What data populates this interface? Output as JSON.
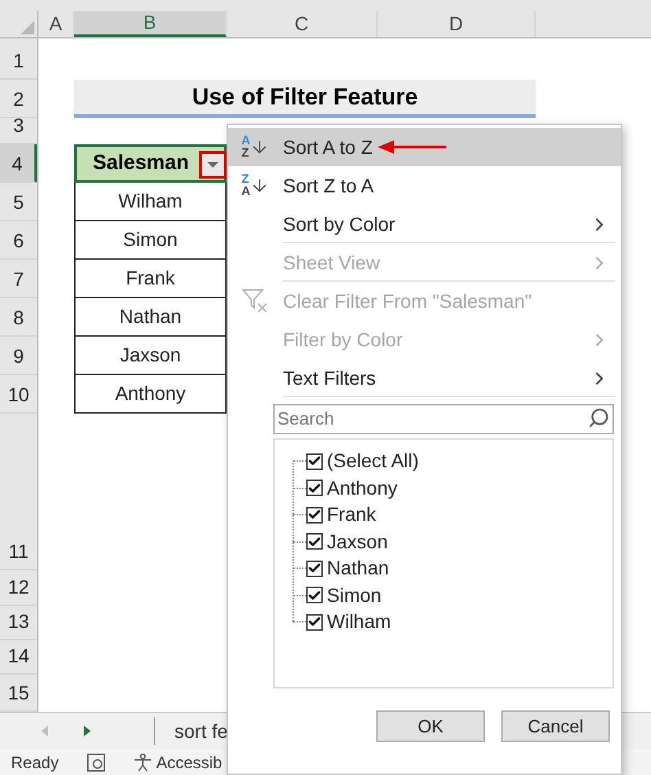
{
  "columns": [
    {
      "label": "A",
      "selected": false
    },
    {
      "label": "B",
      "selected": true
    },
    {
      "label": "C",
      "selected": false
    },
    {
      "label": "D",
      "selected": false
    }
  ],
  "row_numbers": [
    {
      "label": "1",
      "selected": false
    },
    {
      "label": "2",
      "selected": false
    },
    {
      "label": "3",
      "selected": false
    },
    {
      "label": "4",
      "selected": true
    },
    {
      "label": "5",
      "selected": false
    },
    {
      "label": "6",
      "selected": false
    },
    {
      "label": "7",
      "selected": false
    },
    {
      "label": "8",
      "selected": false
    },
    {
      "label": "9",
      "selected": false
    },
    {
      "label": "10",
      "selected": false
    },
    {
      "label": "11",
      "selected": false
    },
    {
      "label": "12",
      "selected": false
    },
    {
      "label": "13",
      "selected": false
    },
    {
      "label": "14",
      "selected": false
    },
    {
      "label": "15",
      "selected": false
    }
  ],
  "title": "Use of Filter Feature",
  "table": {
    "header": "Salesman",
    "rows": [
      "Wilham",
      "Simon",
      "Frank",
      "Nathan",
      "Jaxson",
      "Anthony"
    ]
  },
  "filter_menu": {
    "items": [
      {
        "kind": "sort",
        "icon_text": [
          "A",
          "Z"
        ],
        "label": "Sort A to Z",
        "selected": true,
        "disabled": false,
        "submenu": false,
        "divider_after": false
      },
      {
        "kind": "sort",
        "icon_text": [
          "Z",
          "A"
        ],
        "label": "Sort Z to A",
        "selected": false,
        "disabled": false,
        "submenu": false,
        "divider_after": false
      },
      {
        "kind": "plain",
        "label": "Sort by Color",
        "selected": false,
        "disabled": false,
        "submenu": true,
        "divider_after": true
      },
      {
        "kind": "plain",
        "label": "Sheet View",
        "selected": false,
        "disabled": true,
        "submenu": true,
        "divider_after": true
      },
      {
        "kind": "clear-filter",
        "label": "Clear Filter From \"Salesman\"",
        "selected": false,
        "disabled": true,
        "submenu": false,
        "divider_after": false
      },
      {
        "kind": "plain",
        "label": "Filter by Color",
        "selected": false,
        "disabled": true,
        "submenu": true,
        "divider_after": false
      },
      {
        "kind": "plain",
        "label": "Text Filters",
        "selected": false,
        "disabled": false,
        "submenu": true,
        "divider_after": true
      }
    ],
    "search": {
      "placeholder": "Search"
    },
    "list": [
      {
        "label": "(Select All)",
        "checked": true
      },
      {
        "label": "Anthony",
        "checked": true
      },
      {
        "label": "Frank",
        "checked": true
      },
      {
        "label": "Jaxson",
        "checked": true
      },
      {
        "label": "Nathan",
        "checked": true
      },
      {
        "label": "Simon",
        "checked": true
      },
      {
        "label": "Wilham",
        "checked": true
      }
    ],
    "buttons": [
      "OK",
      "Cancel"
    ]
  },
  "sheet_tabs": [
    {
      "label": "sort fe"
    }
  ],
  "status_bar": {
    "text": "Ready",
    "accessibility": "Accessib"
  }
}
